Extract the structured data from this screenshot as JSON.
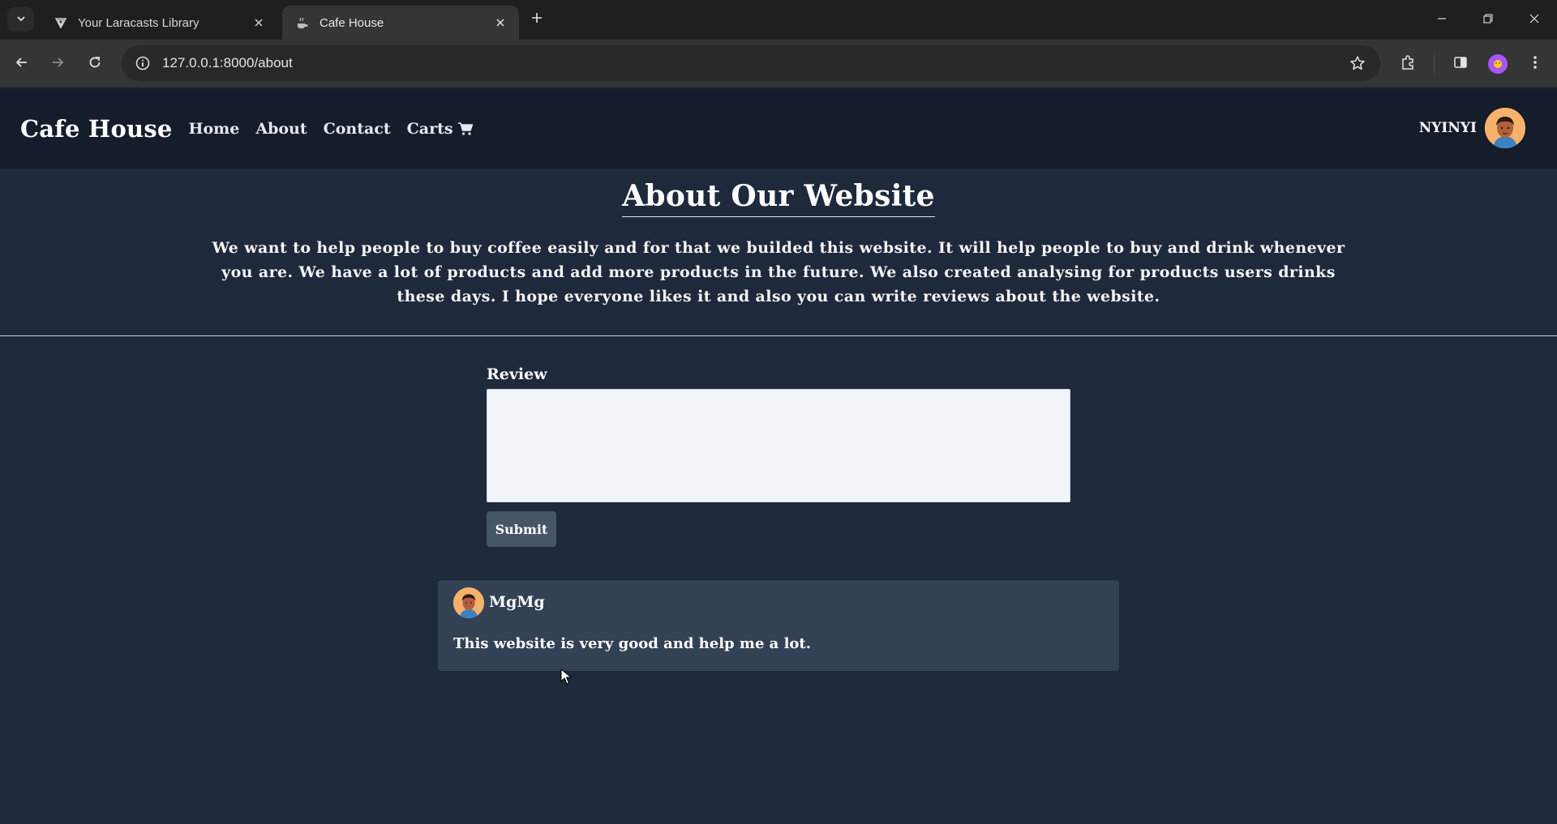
{
  "browser": {
    "tabs": [
      {
        "title": "Your Laracasts Library",
        "active": false,
        "favicon": "laracasts-icon"
      },
      {
        "title": "Cafe House",
        "active": true,
        "favicon": "cafe-icon"
      }
    ],
    "url": "127.0.0.1:8000/about"
  },
  "site": {
    "brand": "Cafe House",
    "nav": {
      "home": "Home",
      "about": "About",
      "contact": "Contact",
      "carts": "Carts"
    },
    "user": {
      "name": "NYINYI"
    }
  },
  "about": {
    "title": "About Our Website",
    "body": "We want to help people to buy coffee easily and for that we builded this website. It will help people to buy and drink whenever you are. We have a lot of products and add more products in the future. We also created analysing for products users drinks these days. I hope everyone likes it and also you can write reviews about the website."
  },
  "review_form": {
    "label": "Review",
    "value": "",
    "submit_label": "Submit"
  },
  "reviews": [
    {
      "author": "MgMg",
      "text": "This website is very good and help me a lot."
    }
  ],
  "colors": {
    "page_bg": "#1e293b",
    "header_bg": "#151c2b",
    "card_bg": "#334155",
    "button_bg": "#475569",
    "input_bg": "#f1f5f9"
  }
}
